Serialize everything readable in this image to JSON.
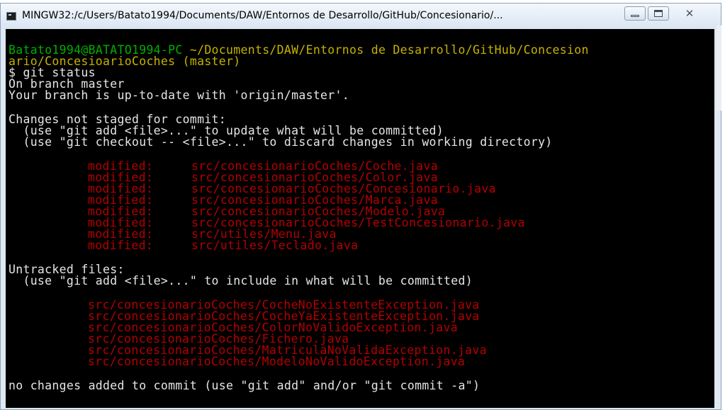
{
  "window": {
    "title": "MINGW32:/c/Users/Batato1994/Documents/DAW/Entornos de Desarrollo/GitHub/Concesionario/...",
    "close_glyph": "✕",
    "icons": [
      "terminal-app-icon",
      "minimize-icon",
      "maximize-icon",
      "close-icon"
    ]
  },
  "terminal": {
    "prompt_user": "Batato1994@BATATO1994-PC",
    "prompt_path": "~/Documents/DAW/Entornos de Desarrollo/GitHub/Concesion",
    "prompt_path_cont": "ario/ConcesioarioCoches",
    "prompt_branch": "(master)",
    "command": "$ git status",
    "on_branch": "On branch master",
    "up_to_date": "Your branch is up-to-date with 'origin/master'.",
    "changes_header": "Changes not staged for commit:",
    "changes_hint1": "  (use \"git add <file>...\" to update what will be committed)",
    "changes_hint2": "  (use \"git checkout -- <file>...\" to discard changes in working directory)",
    "modified": [
      {
        "status": "modified:",
        "file": "src/concesionarioCoches/Coche.java"
      },
      {
        "status": "modified:",
        "file": "src/concesionarioCoches/Color.java"
      },
      {
        "status": "modified:",
        "file": "src/concesionarioCoches/Concesionario.java"
      },
      {
        "status": "modified:",
        "file": "src/concesionarioCoches/Marca.java"
      },
      {
        "status": "modified:",
        "file": "src/concesionarioCoches/Modelo.java"
      },
      {
        "status": "modified:",
        "file": "src/concesionarioCoches/TestConcesionario.java"
      },
      {
        "status": "modified:",
        "file": "src/utiles/Menu.java"
      },
      {
        "status": "modified:",
        "file": "src/utiles/Teclado.java"
      }
    ],
    "untracked_header": "Untracked files:",
    "untracked_hint": "  (use \"git add <file>...\" to include in what will be committed)",
    "untracked": [
      "src/concesionarioCoches/CocheNoExistenteException.java",
      "src/concesionarioCoches/CocheYaExistenteException.java",
      "src/concesionarioCoches/ColorNoValidoException.java",
      "src/concesionarioCoches/Fichero.java",
      "src/concesionarioCoches/MatriculaNoValidaException.java",
      "src/concesionarioCoches/ModeloNoValidoException.java"
    ],
    "footer": "no changes added to commit (use \"git add\" and/or \"git commit -a\")"
  },
  "colors": {
    "terminal_bg": "#000000",
    "prompt_user": "#00b000",
    "prompt_path": "#c5b300",
    "file_red": "#b40000",
    "text": "#e6e6e6"
  }
}
